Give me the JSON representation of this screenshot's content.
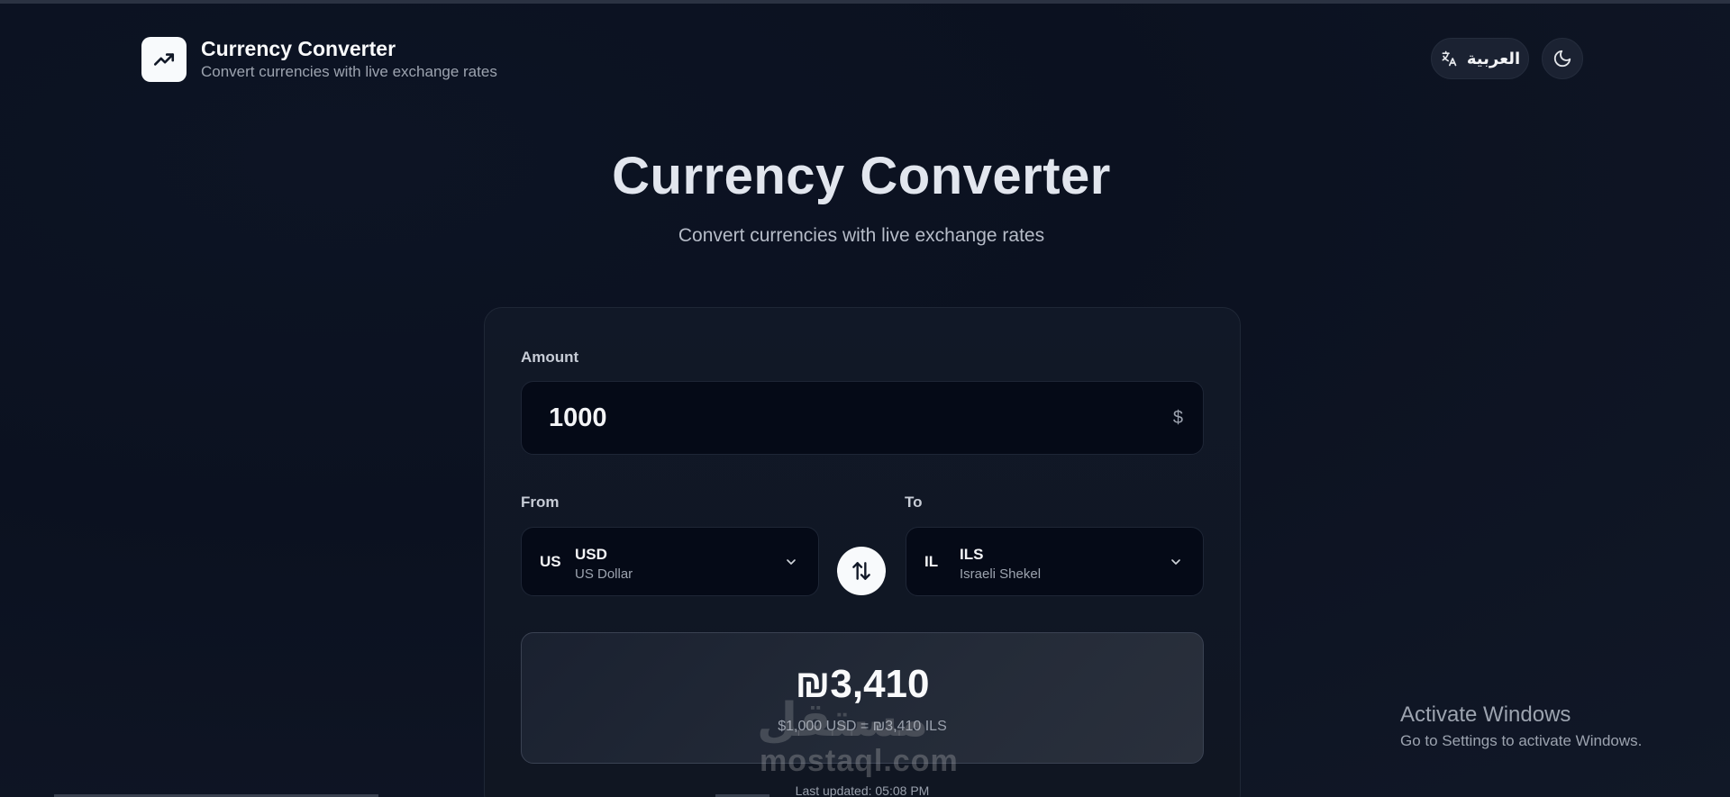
{
  "header": {
    "title": "Currency Converter",
    "subtitle": "Convert currencies with live exchange rates",
    "language_label": "العربية",
    "logo_icon": "trending-up-icon",
    "language_icon": "translate-icon",
    "theme_icon": "moon-icon"
  },
  "hero": {
    "title": "Currency Converter",
    "subtitle": "Convert currencies with live exchange rates"
  },
  "converter": {
    "amount_label": "Amount",
    "amount_value": "1000",
    "amount_symbol": "$",
    "from_label": "From",
    "to_label": "To",
    "from": {
      "flag": "US",
      "code": "USD",
      "name": "US Dollar"
    },
    "to": {
      "flag": "IL",
      "code": "ILS",
      "name": "Israeli Shekel"
    },
    "swap_icon": "swap-vertical-icon",
    "result_value": "₪3,410",
    "result_detail": "$1,000 USD = ₪3,410 ILS",
    "last_updated": "Last updated: 05:08 PM"
  },
  "watermark": {
    "arabic": "مستقل",
    "latin": "mostaql.com"
  },
  "windows_notice": {
    "title": "Activate Windows",
    "subtitle": "Go to Settings to activate Windows."
  },
  "colors": {
    "background": "#0b1120",
    "card": "#111827",
    "input": "#050a17",
    "accent": "#f8fafc"
  }
}
